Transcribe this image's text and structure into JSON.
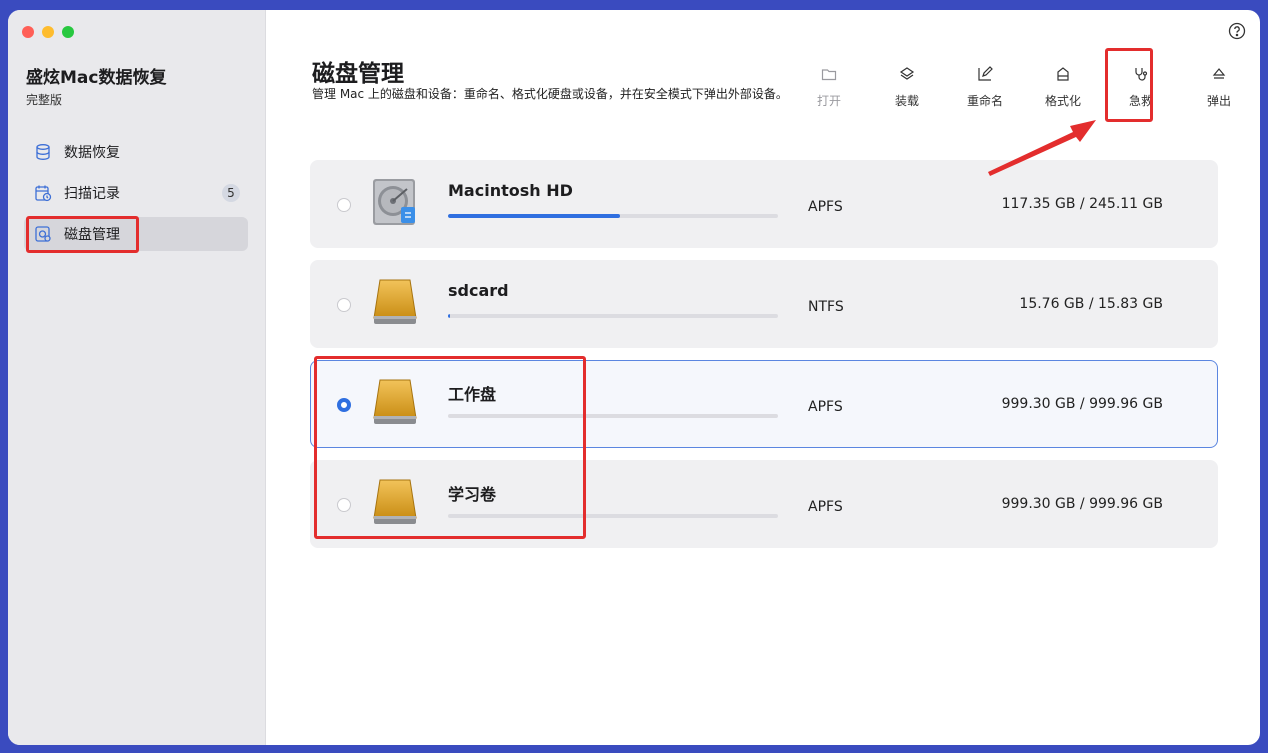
{
  "app": {
    "title": "盛炫Mac数据恢复",
    "edition": "完整版"
  },
  "sidebar": {
    "items": [
      {
        "label": "数据恢复",
        "icon": "database-icon"
      },
      {
        "label": "扫描记录",
        "icon": "calendar-clock-icon",
        "badge": "5"
      },
      {
        "label": "磁盘管理",
        "icon": "disk-manage-icon",
        "active": true
      }
    ]
  },
  "main": {
    "title": "磁盘管理",
    "description": "管理 Mac 上的磁盘和设备：重命名、格式化硬盘或设备，并在安全模式下弹出外部设备。"
  },
  "toolbar": {
    "open": "打开",
    "mount": "装载",
    "rename": "重命名",
    "format": "格式化",
    "rescue": "急救",
    "eject": "弹出"
  },
  "disks": [
    {
      "name": "Macintosh HD",
      "fs": "APFS",
      "capacity": "117.35 GB / 245.11 GB",
      "usage_fraction": 0.52,
      "selected": false,
      "icon": "internal-hdd-icon"
    },
    {
      "name": "sdcard",
      "fs": "NTFS",
      "capacity": "15.76 GB / 15.83 GB",
      "usage_fraction": 0.005,
      "selected": false,
      "icon": "external-drive-icon"
    },
    {
      "name": "工作盘",
      "fs": "APFS",
      "capacity": "999.30 GB / 999.96 GB",
      "usage_fraction": 0.0,
      "selected": true,
      "icon": "external-drive-icon"
    },
    {
      "name": "学习卷",
      "fs": "APFS",
      "capacity": "999.30 GB / 999.96 GB",
      "usage_fraction": 0.0,
      "selected": false,
      "icon": "external-drive-icon"
    }
  ],
  "colors": {
    "accent": "#2f6fe0",
    "highlight": "#e32d2d",
    "sidebar_bg": "#e9e9ec",
    "row_bg": "#f0f0f2"
  }
}
